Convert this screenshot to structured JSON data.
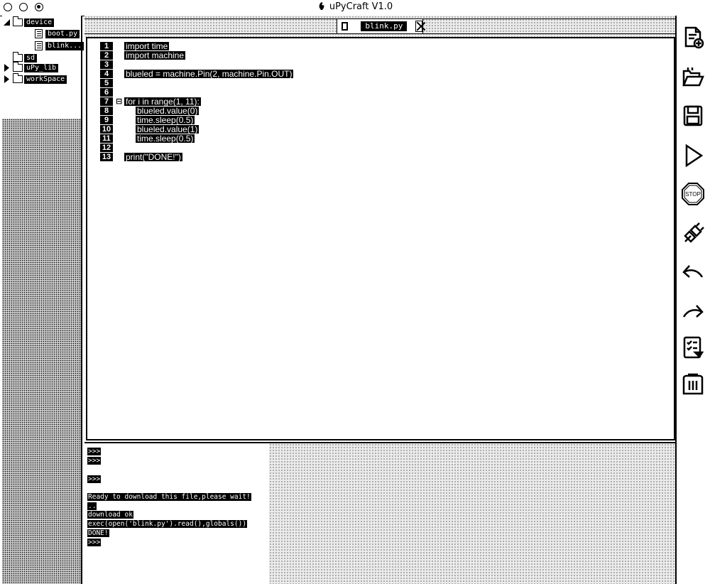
{
  "window": {
    "title": "uPyCraft V1.0"
  },
  "tree": {
    "items": [
      {
        "label": "device",
        "kind": "folder"
      },
      {
        "label": "boot.py",
        "kind": "file"
      },
      {
        "label": "blink...",
        "kind": "file"
      },
      {
        "label": "sd",
        "kind": "folder"
      },
      {
        "label": "uPy_lib",
        "kind": "folder"
      },
      {
        "label": "workSpace",
        "kind": "folder"
      }
    ]
  },
  "editor": {
    "tab_label": "blink.py",
    "lines": [
      {
        "no": "1",
        "text": "import time"
      },
      {
        "no": "2",
        "text": "import machine"
      },
      {
        "no": "3",
        "text": ""
      },
      {
        "no": "4",
        "text": "blueled = machine.Pin(2, machine.Pin.OUT)"
      },
      {
        "no": "5",
        "text": ""
      },
      {
        "no": "6",
        "text": ""
      },
      {
        "no": "7",
        "text": "for i in range(1, 11):"
      },
      {
        "no": "8",
        "text": "blueled.value(0)"
      },
      {
        "no": "9",
        "text": "time.sleep(0.5)"
      },
      {
        "no": "10",
        "text": "blueled.value(1)"
      },
      {
        "no": "11",
        "text": "time.sleep(0.5)"
      },
      {
        "no": "12",
        "text": ""
      },
      {
        "no": "13",
        "text": "print(\"DONE!\")"
      }
    ],
    "fold_marker": "⊟"
  },
  "console": {
    "lines": [
      ">>>",
      ">>>",
      "",
      ">>>",
      "",
      "Ready to download this file,please wait!",
      "..",
      "download ok",
      "exec(open('blink.py').read(),globals())",
      "DONE!",
      ">>>"
    ]
  },
  "toolbar": {
    "tools": [
      "new-file-icon",
      "open-folder-icon",
      "save-icon",
      "run-icon",
      "stop-icon",
      "connect-icon",
      "undo-icon",
      "redo-icon",
      "syntax-check-icon",
      "clear-icon"
    ],
    "stop_label": "STOP"
  }
}
